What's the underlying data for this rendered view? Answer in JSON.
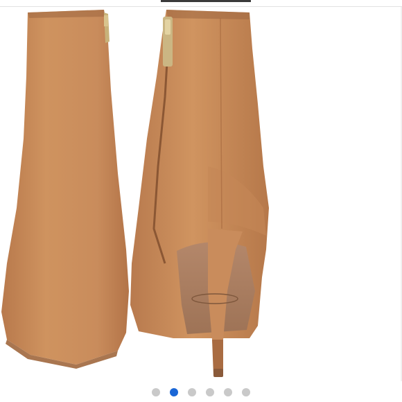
{
  "gallery": {
    "image_alt": "",
    "slide_count": 6,
    "active_index": 1,
    "colors": {
      "suede": "#c98c5c",
      "suede_shadow": "#a96c42",
      "suede_highlight": "#d9a27a",
      "sole": "#b98a66",
      "insole": "#a87b5c",
      "zipper": "#c8b27a",
      "dot_active": "#1a66d6",
      "dot_inactive": "#c9c9c9"
    },
    "dots": [
      {
        "label": ""
      },
      {
        "label": ""
      },
      {
        "label": ""
      },
      {
        "label": ""
      },
      {
        "label": ""
      },
      {
        "label": ""
      }
    ]
  }
}
